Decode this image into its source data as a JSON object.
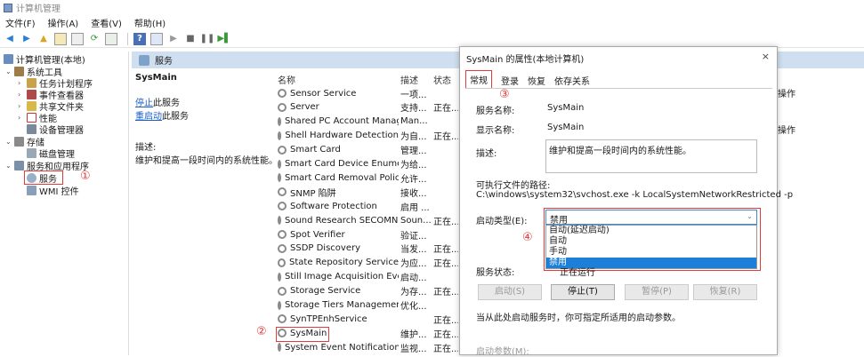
{
  "window": {
    "title": "计算机管理"
  },
  "menu": [
    "文件(F)",
    "操作(A)",
    "查看(V)",
    "帮助(H)"
  ],
  "tree": {
    "root": "计算机管理(本地)",
    "system_tools": "系统工具",
    "task_scheduler": "任务计划程序",
    "event_viewer": "事件查看器",
    "shared_folders": "共享文件夹",
    "performance": "性能",
    "device_manager": "设备管理器",
    "storage": "存储",
    "disk_mgmt": "磁盘管理",
    "services_apps": "服务和应用程序",
    "services": "服务",
    "wmi": "WMI 控件"
  },
  "annotations": {
    "one": "①",
    "two": "②",
    "three": "③",
    "four": "④"
  },
  "services_panel": {
    "header": "服务",
    "selected_name": "SysMain",
    "stop_link": "停止",
    "stop_suffix": "此服务",
    "restart_link": "重启动",
    "restart_suffix": "此服务",
    "desc_label": "描述:",
    "desc_text": "维护和提高一段时间内的系统性能。",
    "columns": {
      "name": "名称",
      "desc": "描述",
      "status": "状态"
    },
    "rows": [
      {
        "name": "Sensor Service",
        "desc": "一项...",
        "status": ""
      },
      {
        "name": "Server",
        "desc": "支持...",
        "status": "正在..."
      },
      {
        "name": "Shared PC Account Manager",
        "desc": "Man...",
        "status": ""
      },
      {
        "name": "Shell Hardware Detection",
        "desc": "为自...",
        "status": "正在..."
      },
      {
        "name": "Smart Card",
        "desc": "管理...",
        "status": ""
      },
      {
        "name": "Smart Card Device Enumer...",
        "desc": "为给...",
        "status": ""
      },
      {
        "name": "Smart Card Removal Policy",
        "desc": "允许...",
        "status": ""
      },
      {
        "name": "SNMP 陷阱",
        "desc": "接收...",
        "status": ""
      },
      {
        "name": "Software Protection",
        "desc": "启用 ...",
        "status": ""
      },
      {
        "name": "Sound Research SECOMN ...",
        "desc": "Soun...",
        "status": "正在..."
      },
      {
        "name": "Spot Verifier",
        "desc": "验证...",
        "status": ""
      },
      {
        "name": "SSDP Discovery",
        "desc": "当发...",
        "status": "正在..."
      },
      {
        "name": "State Repository Service",
        "desc": "为应...",
        "status": "正在..."
      },
      {
        "name": "Still Image Acquisition Events",
        "desc": "启动...",
        "status": ""
      },
      {
        "name": "Storage Service",
        "desc": "为存...",
        "status": "正在..."
      },
      {
        "name": "Storage Tiers Management",
        "desc": "优化...",
        "status": ""
      },
      {
        "name": "SynTPEnhService",
        "desc": "",
        "status": "正在..."
      },
      {
        "name": "SysMain",
        "desc": "维护...",
        "status": "正在..."
      },
      {
        "name": "System Event Notification S...",
        "desc": "监视...",
        "status": "正在..."
      }
    ]
  },
  "dialog": {
    "title": "SysMain 的属性(本地计算机)",
    "close": "×",
    "tabs": [
      "常规",
      "登录",
      "恢复",
      "依存关系"
    ],
    "service_name_label": "服务名称:",
    "service_name": "SysMain",
    "display_name_label": "显示名称:",
    "display_name": "SysMain",
    "desc_label": "描述:",
    "desc": "维护和提高一段时间内的系统性能。",
    "exe_path_label": "可执行文件的路径:",
    "exe_path": "C:\\windows\\system32\\svchost.exe -k LocalSystemNetworkRestricted -p",
    "startup_type_label": "启动类型(E):",
    "startup_type_value": "禁用",
    "startup_options": [
      "自动(延迟启动)",
      "自动",
      "手动",
      "禁用"
    ],
    "status_label": "服务状态:",
    "status_value": "正在运行",
    "buttons": {
      "start": "启动(S)",
      "stop": "停止(T)",
      "pause": "暂停(P)",
      "resume": "恢复(R)"
    },
    "hint": "当从此处启动服务时，你可指定所适用的启动参数。",
    "params_label": "启动参数(M):"
  },
  "right_panel": {
    "item1": "操作",
    "item2": "操作"
  }
}
